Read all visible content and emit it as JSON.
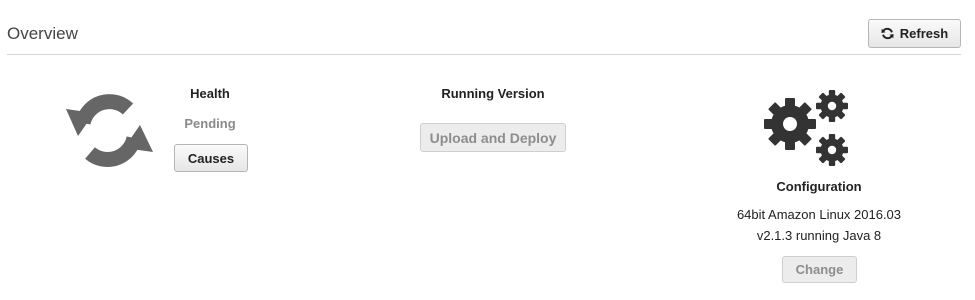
{
  "overview": {
    "title": "Overview",
    "refresh_label": "Refresh",
    "refresh_icon": "refresh-icon"
  },
  "health": {
    "label": "Health",
    "status": "Pending",
    "causes_label": "Causes",
    "icon": "health-pending-icon"
  },
  "running_version": {
    "label": "Running Version",
    "upload_label": "Upload and Deploy"
  },
  "configuration": {
    "label": "Configuration",
    "line1": "64bit Amazon Linux 2016.03",
    "line2": "v2.1.3 running Java 8",
    "change_label": "Change",
    "icon": "gears-icon"
  },
  "colors": {
    "icon_gray": "#666666",
    "gear_dark": "#333333",
    "pending_text": "#8a8a8a",
    "divider": "#d5d5d5"
  }
}
